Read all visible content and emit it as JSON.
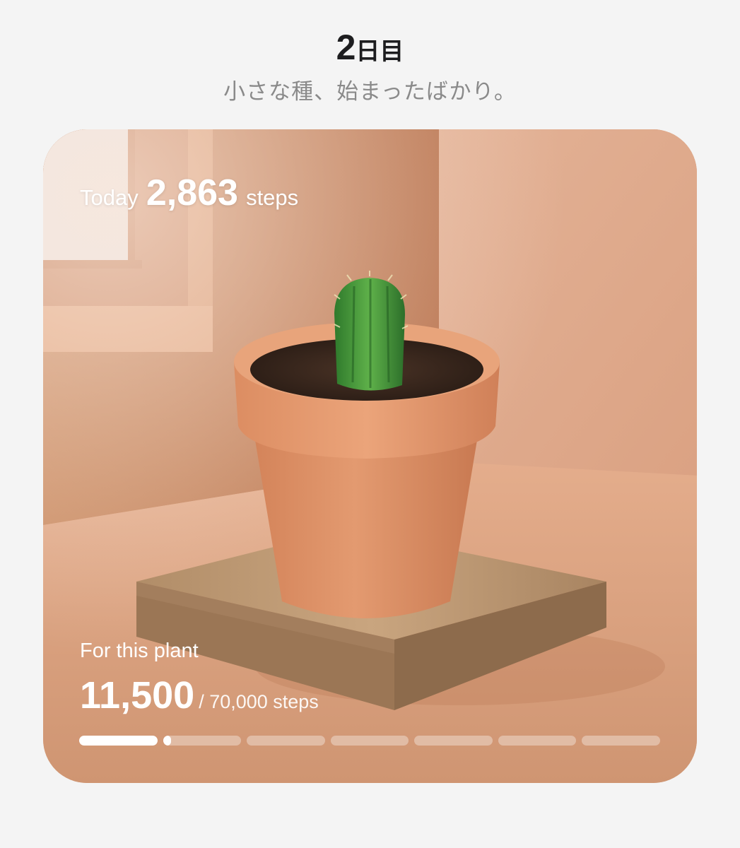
{
  "header": {
    "day_number": "2",
    "day_suffix": "日目",
    "subtitle": "小さな種、始まったばかり。"
  },
  "card": {
    "today_label": "Today",
    "today_steps": "2,863",
    "today_unit": "steps",
    "plant_label": "For this plant",
    "plant_steps": "11,500",
    "plant_total": "/ 70,000 steps",
    "progress": {
      "current": 11500,
      "goal": 70000,
      "segments": 7,
      "segment_fill": [
        1,
        0.1,
        0,
        0,
        0,
        0,
        0
      ]
    }
  }
}
